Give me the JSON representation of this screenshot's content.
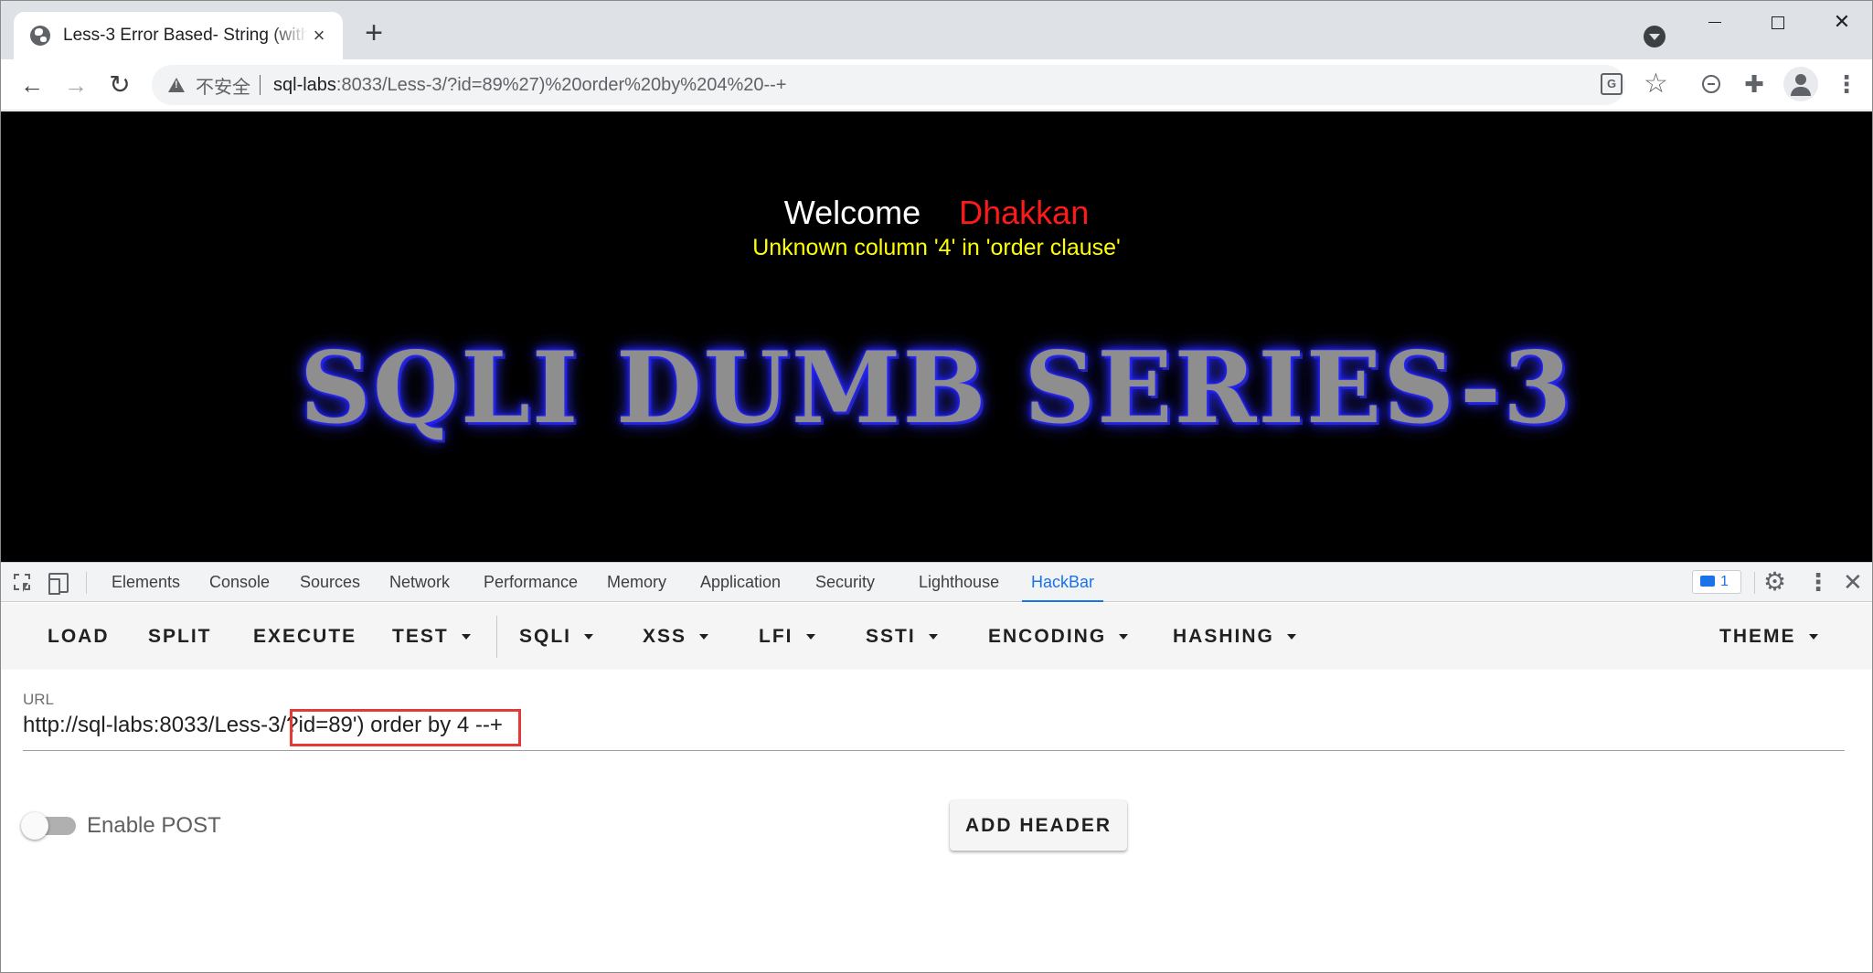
{
  "browser": {
    "tab_title": "Less-3 Error Based- String (with Twist)",
    "tab_close": "×",
    "new_tab": "+",
    "insecure_label": "不安全",
    "url_host": "sql-labs",
    "url_rest": ":8033/Less-3/?id=89%27)%20order%20by%204%20--+",
    "translate_glyph": "G",
    "star_glyph": "☆",
    "puzzle_glyph": "✚",
    "menu_glyph": "⋮",
    "back_glyph": "←",
    "forward_glyph": "→",
    "reload_glyph": "↻",
    "close_glyph": "✕"
  },
  "page": {
    "welcome": "Welcome",
    "name": "Dhakkan",
    "error": "Unknown column '4' in 'order clause'",
    "banner": "SQLI DUMB SERIES-3",
    "colors": {
      "background": "#000000",
      "welcome": "#ffffff",
      "name": "#ff1a1a",
      "error": "#ffff00"
    }
  },
  "devtools": {
    "tabs": [
      "Elements",
      "Console",
      "Sources",
      "Network",
      "Performance",
      "Memory",
      "Application",
      "Security",
      "Lighthouse",
      "HackBar"
    ],
    "active_tab": "HackBar",
    "issues_count": "1",
    "gear_glyph": "⚙",
    "more_glyph": "⋮",
    "close_glyph": "✕"
  },
  "hackbar": {
    "buttons": {
      "load": "LOAD",
      "split": "SPLIT",
      "execute": "EXECUTE",
      "test": "TEST",
      "sqli": "SQLI",
      "xss": "XSS",
      "lfi": "LFI",
      "ssti": "SSTI",
      "encoding": "ENCODING",
      "hashing": "HASHING",
      "theme": "THEME"
    },
    "url_label": "URL",
    "url_value": "http://sql-labs:8033/Less-3/?id=89') order by 4 --+",
    "enable_post_label": "Enable POST",
    "enable_post_on": false,
    "add_header": "ADD HEADER",
    "highlight_color": "#e53935"
  }
}
